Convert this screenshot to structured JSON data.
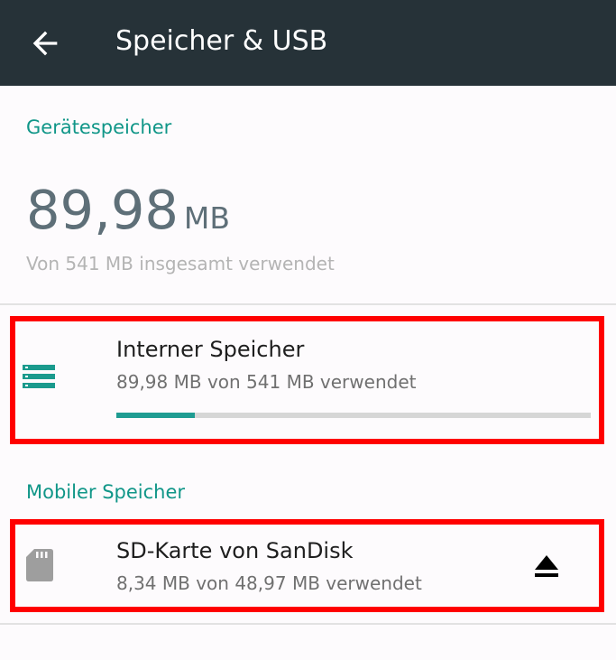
{
  "app_bar": {
    "title": "Speicher & USB",
    "back_icon": "arrow-back-icon",
    "background": "#263238"
  },
  "device_storage": {
    "header": "Gerätespeicher",
    "used_value": "89,98",
    "used_unit": "MB",
    "summary": "Von 541 MB insgesamt verwendet"
  },
  "internal_storage": {
    "icon": "storage-icon",
    "title": "Interner Speicher",
    "subtitle": "89,98 MB von 541 MB verwendet",
    "used_fraction": 0.166
  },
  "portable_storage": {
    "header": "Mobiler Speicher",
    "sd_card": {
      "icon": "sd-card-icon",
      "title": "SD-Karte von SanDisk",
      "subtitle": "8,34 MB von 48,97 MB verwendet",
      "action_icon": "eject-icon"
    }
  },
  "colors": {
    "accent": "#109688",
    "progress_fill": "#1f9c92",
    "highlight": "#ff0000"
  }
}
